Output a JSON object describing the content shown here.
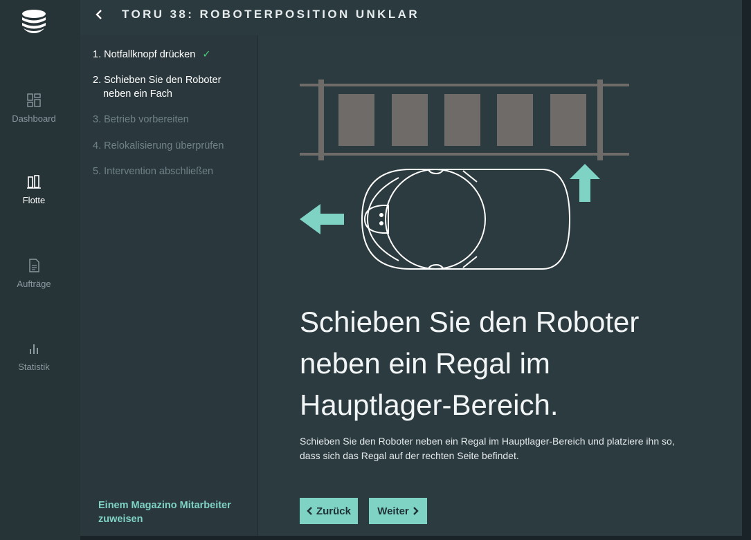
{
  "header": {
    "back_icon": "chevron-left-icon",
    "title": "TORU 38: ROBOTERPOSITION UNKLAR"
  },
  "nav": {
    "logo": "magazino-logo",
    "items": [
      {
        "label": "Dashboard",
        "icon": "dashboard-grid-icon",
        "active": false
      },
      {
        "label": "Flotte",
        "icon": "fleet-icon",
        "active": true
      },
      {
        "label": "Aufträge",
        "icon": "document-icon",
        "active": false
      },
      {
        "label": "Statistik",
        "icon": "bar-chart-icon",
        "active": false
      }
    ]
  },
  "steps": {
    "items": [
      {
        "number": "1.",
        "label": "Notfallknopf drücken",
        "state": "done"
      },
      {
        "number": "2.",
        "label_line1": "Schieben Sie den Roboter",
        "label_line2": "neben ein Fach",
        "state": "current"
      },
      {
        "number": "3.",
        "label": "Betrieb vorbereiten",
        "state": "pending"
      },
      {
        "number": "4.",
        "label": "Relokalisierung überprüfen",
        "state": "pending"
      },
      {
        "number": "5.",
        "label": "Intervention abschließen",
        "state": "pending"
      }
    ],
    "assign_link_line1": "Einem Magazino Mitarbeiter",
    "assign_link_line2": "zuweisen"
  },
  "main": {
    "headline_line1": "Schieben Sie den Roboter",
    "headline_line2": "neben ein Regal im",
    "headline_line3": "Hauptlager-Bereich.",
    "description_line1": "Schieben Sie den Roboter neben ein Regal im Hauptlager-Bereich und platziere ihn so,",
    "description_line2": "dass sich das Regal auf der rechten Seite befindet.",
    "back_button": "Zurück",
    "next_button": "Weiter"
  },
  "colors": {
    "accent": "#7fd3c5",
    "check": "#49d17a",
    "background": "#2c3b40",
    "rail": "#263337",
    "shelf": "#6f6b68"
  }
}
